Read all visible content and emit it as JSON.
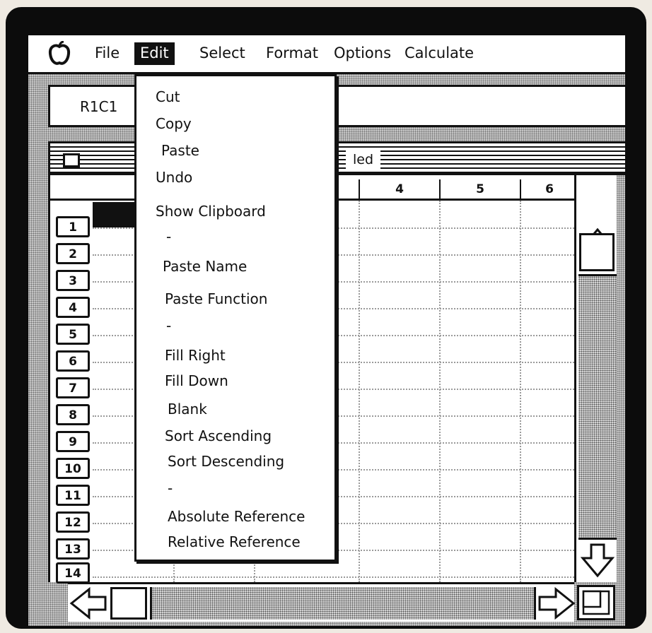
{
  "menubar": {
    "items": [
      "File",
      "Edit",
      "Select",
      "Format",
      "Options",
      "Calculate"
    ],
    "active": "Edit"
  },
  "formula_bar": {
    "cell_ref": "R1C1"
  },
  "sheet": {
    "title_fragment": "led",
    "column_headers": [
      "4",
      "5",
      "6"
    ],
    "row_headers": [
      "1",
      "2",
      "3",
      "4",
      "5",
      "6",
      "7",
      "8",
      "9",
      "10",
      "11",
      "12",
      "13",
      "14"
    ]
  },
  "edit_menu": {
    "items": [
      "Cut",
      "Copy",
      "Paste",
      "Undo",
      "Show Clipboard",
      "-",
      "Paste Name",
      "Paste Function",
      "-",
      "Fill Right",
      "Fill Down",
      "Blank",
      "Sort Ascending",
      "Sort Descending",
      "-",
      "Absolute Reference",
      "Relative Reference"
    ]
  },
  "icons": {
    "apple_logo": "apple-icon",
    "close_box": "close-box-icon",
    "scroll_up": "arrow-up-icon",
    "scroll_down": "arrow-down-icon",
    "scroll_left": "arrow-left-icon",
    "scroll_right": "arrow-right-icon",
    "size_box": "resize-icon"
  },
  "colors": {
    "foreground": "#111111",
    "background": "#ffffff",
    "pattern": "#c9c9c9"
  }
}
